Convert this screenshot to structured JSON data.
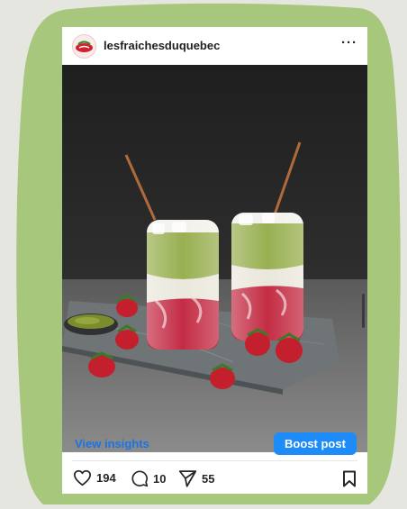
{
  "post": {
    "username": "lesfraichesduquebec",
    "more_label": "···",
    "image_subject": "two layered matcha strawberry drinks with copper straws"
  },
  "actions": {
    "view_insights_label": "View insights",
    "boost_label": "Boost post",
    "likes": "194",
    "comments": "10",
    "shares": "55"
  },
  "colors": {
    "frame_green": "#a6c77c",
    "link_blue": "#1b74e4",
    "boost_blue": "#1d8cf8",
    "brand_red": "#d3202f"
  },
  "icons": [
    "heart-icon",
    "comment-icon",
    "share-icon",
    "bookmark-icon",
    "more-icon",
    "brand-logo"
  ]
}
